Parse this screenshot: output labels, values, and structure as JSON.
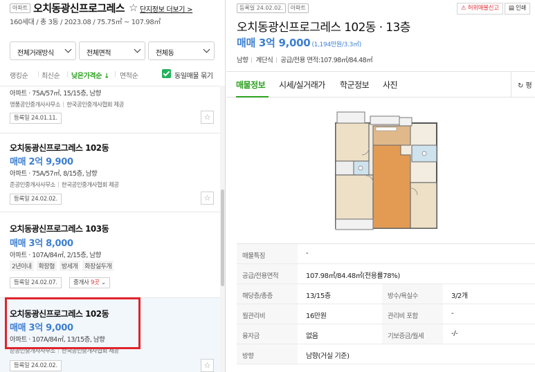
{
  "complex": {
    "tag": "아파트",
    "name": "오치동광신프로그레스",
    "star_icon": "star-outline-icon",
    "link": "단지정보 더보기",
    "summary": "160세대 / 총 3동 / 2023.08 / 75.75㎡ ~ 107.98㎡"
  },
  "filters": [
    {
      "label": "전체거래방식"
    },
    {
      "label": "전체면적"
    },
    {
      "label": "전체동"
    }
  ],
  "sorts": [
    {
      "label": "랭킹순",
      "active": false
    },
    {
      "label": "최신순",
      "active": false
    },
    {
      "label": "낮은가격순 ↓",
      "active": true
    },
    {
      "label": "면적순",
      "active": false
    }
  ],
  "same_listing_toggle": {
    "label": "동일매물 묶기",
    "checked": true
  },
  "listings": [
    {
      "info": "아파트 · 75A/57㎡, 15/15층, 남향",
      "agent": "명품공인중개사사무소",
      "provider": "한국공인중개사협회 제공",
      "date": "등록일 24.01.11."
    },
    {
      "title": "오치동광신프로그레스 102동",
      "price": "매매 2억 9,900",
      "info": "아파트 · 75A/57㎡, 8/15층, 남향",
      "agent": "준공인중개사사무소",
      "provider": "한국공인중개사협회 제공",
      "date": "등록일 24.02.02."
    },
    {
      "title": "오치동광신프로그레스 103동",
      "price": "매매 3억 8,000",
      "info": "아파트 · 107A/84㎡, 2/15층, 남향",
      "chips": [
        "2년이내",
        "확장형",
        "방세개",
        "화장실두개"
      ],
      "date": "등록일 24.02.07.",
      "agents_prefix": "중개사 ",
      "agents_count": "9곳"
    },
    {
      "title": "오치동광신프로그레스 102동",
      "price": "매매 3억 9,000",
      "info": "아파트 · 107A/84㎡, 13/15층, 남향",
      "agent": "준공인중개사사무소",
      "provider": "한국공인중개사협회 제공",
      "date": "등록일 24.02.02."
    }
  ],
  "detail": {
    "date_tag": "등록일 24.02.02.",
    "type_tag": "아파트",
    "report_btn": "허위매물신고",
    "print_btn": "인쇄",
    "title": "오치동광신프로그레스 102동 · 13층",
    "price": "매매 3억 9,000",
    "price_unit": "(1,194만원/3.3㎡)",
    "attrs": [
      "남향",
      "계단식",
      "공급/전용 면적:107.98㎡/84.48㎡"
    ],
    "tabs": [
      "매물정보",
      "시세/실거래가",
      "학군정보",
      "사진"
    ],
    "refresh_label": "↻ 평",
    "rows": [
      {
        "cells": [
          {
            "th": "매물특징",
            "td": "-"
          }
        ]
      },
      {
        "cells": [
          {
            "th": "공급/전용면적",
            "td": "107.98㎡/84.48㎡(전용률78%)"
          }
        ]
      },
      {
        "cells": [
          {
            "th": "해당층/총층",
            "td": "13/15층"
          },
          {
            "th": "방수/욕실수",
            "td": "3/2개"
          }
        ]
      },
      {
        "cells": [
          {
            "th": "월관리비",
            "td": "16만원"
          },
          {
            "th": "관리비 포함",
            "td": "-"
          }
        ]
      },
      {
        "cells": [
          {
            "th": "융자금",
            "td": "없음"
          },
          {
            "th": "기보증금/월세",
            "td": "-/-"
          }
        ]
      },
      {
        "cells": [
          {
            "th": "방향",
            "td": "남향(거실 기준)"
          }
        ]
      }
    ]
  },
  "colors": {
    "accent_green": "#2ba01f",
    "price_blue": "#3d7fd1",
    "highlight_red": "#e0232b"
  }
}
